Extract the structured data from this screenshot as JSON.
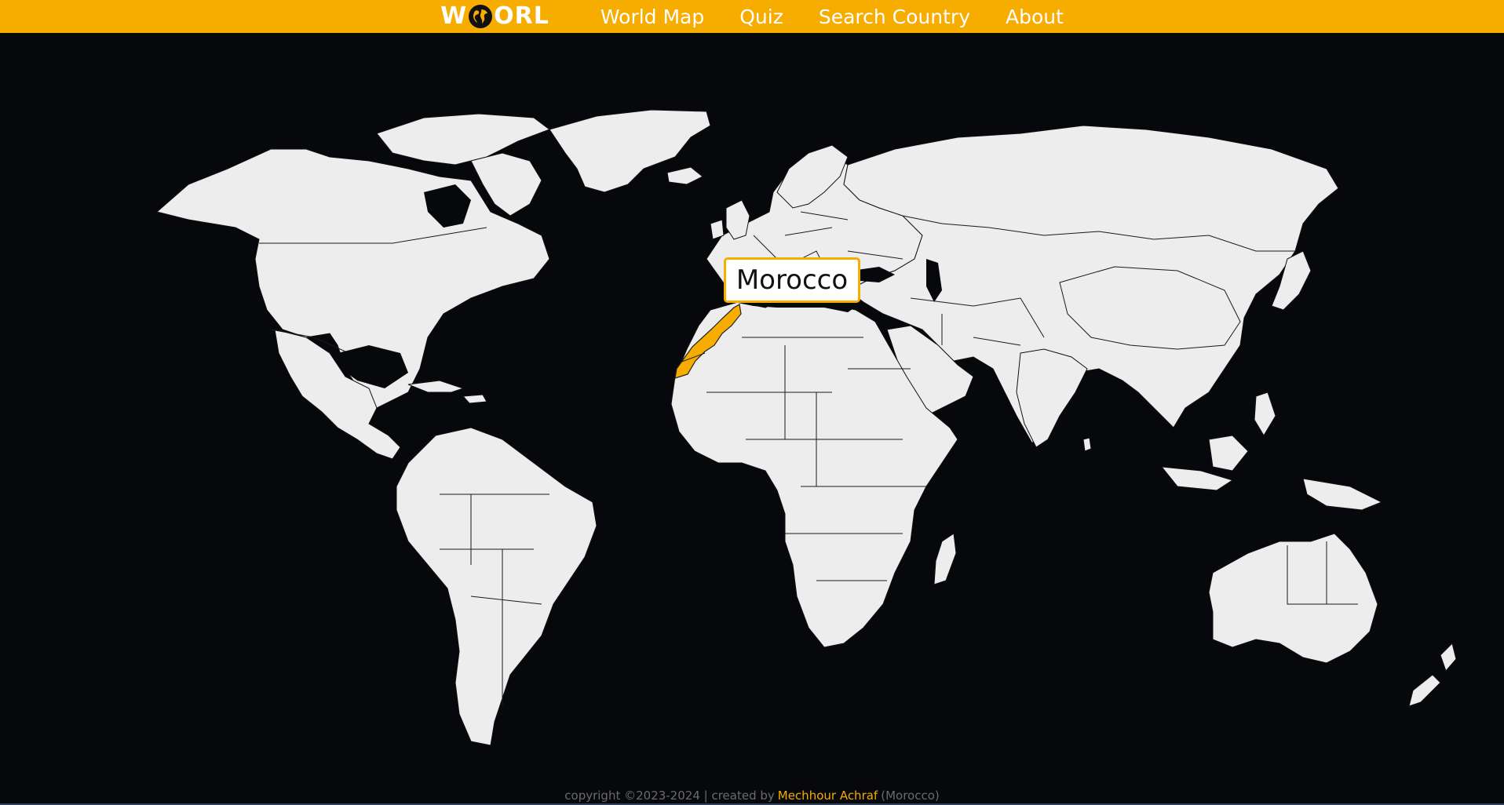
{
  "colors": {
    "accent": "#f7ac00",
    "background": "#06080b",
    "land": "#ededed"
  },
  "logo": {
    "part1": "W",
    "part2": "ORL",
    "globe_icon": "globe-icon"
  },
  "nav": [
    {
      "label": "World Map"
    },
    {
      "label": "Quiz"
    },
    {
      "label": "Search Country"
    },
    {
      "label": "About"
    }
  ],
  "map": {
    "highlighted_country": "Morocco"
  },
  "tooltip": {
    "text": "Morocco"
  },
  "footer": {
    "prefix": "copyright ©2023-2024 | created by",
    "author": "Mechhour Achraf",
    "suffix": "(Morocco)"
  }
}
